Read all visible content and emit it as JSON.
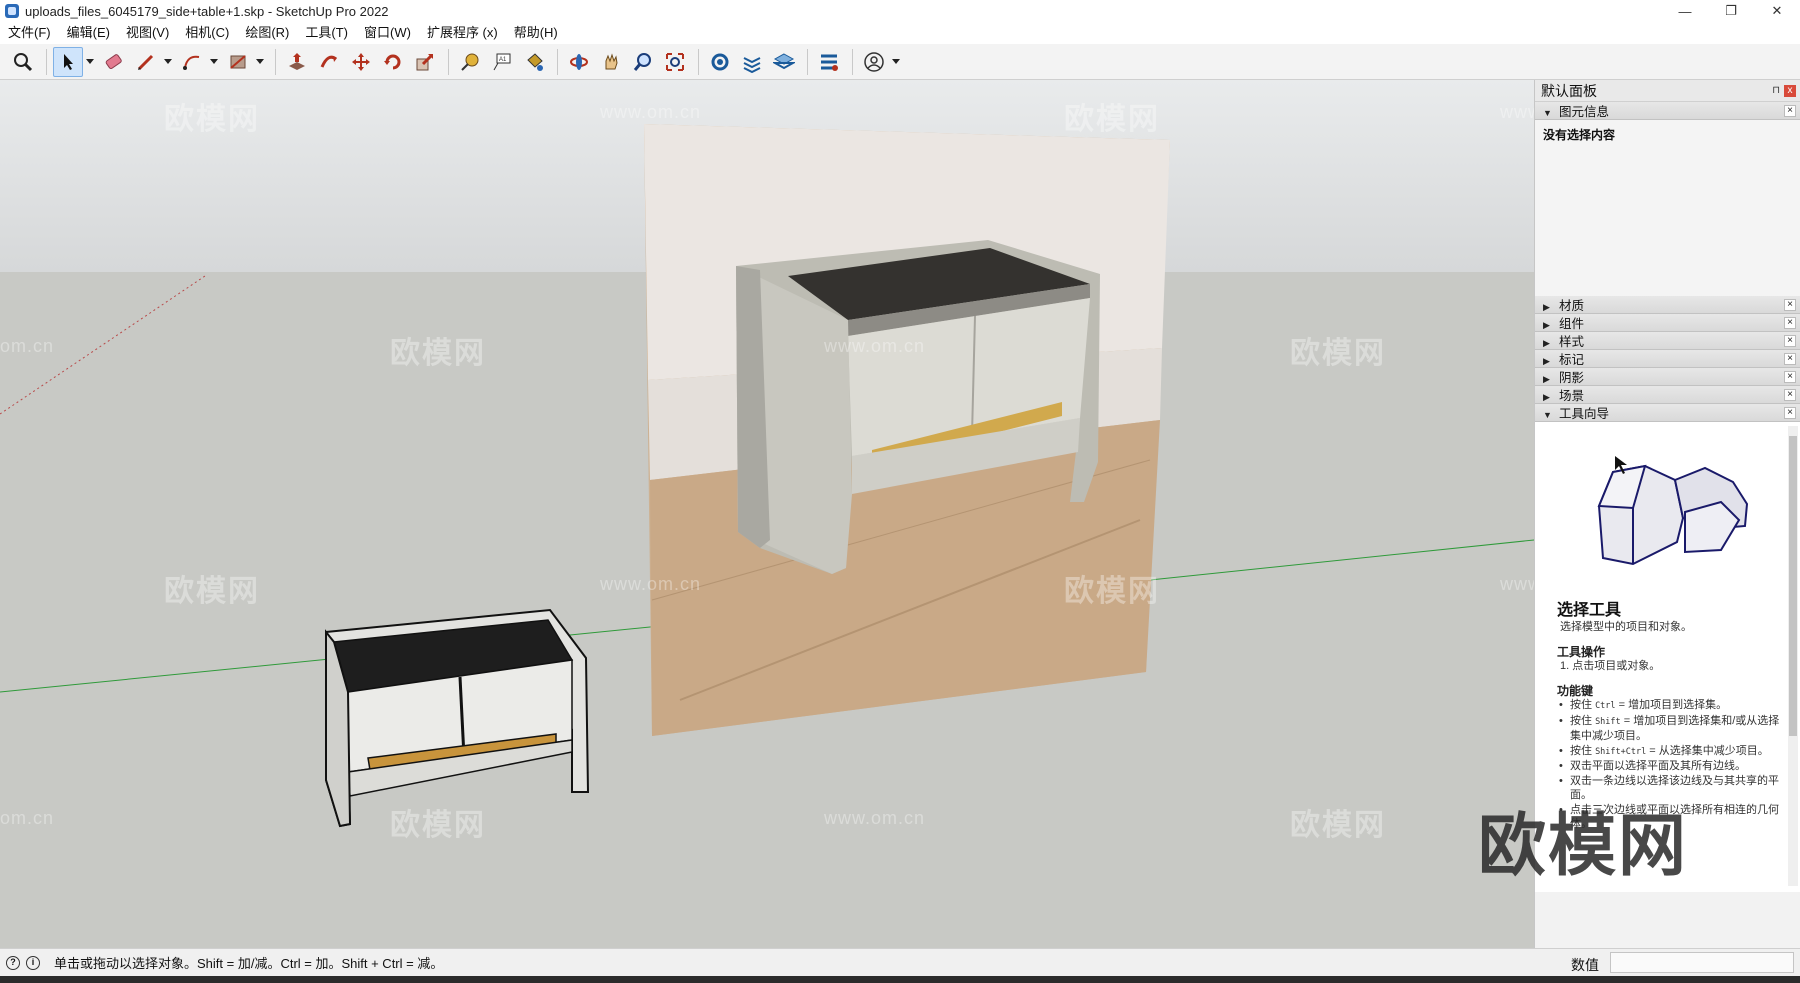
{
  "window": {
    "title": "uploads_files_6045179_side+table+1.skp - SketchUp Pro 2022",
    "minimize": "—",
    "maximize": "❐",
    "close": "✕"
  },
  "menu": [
    "文件(F)",
    "编辑(E)",
    "视图(V)",
    "相机(C)",
    "绘图(R)",
    "工具(T)",
    "窗口(W)",
    "扩展程序 (x)",
    "帮助(H)"
  ],
  "toolbar": {
    "tools": [
      "zoom-extents",
      "select",
      "eraser",
      "pencil-line",
      "arc",
      "rectangle",
      "push-pull",
      "follow-me",
      "move",
      "rotate",
      "scale",
      "tape-measure",
      "text",
      "paint-bucket",
      "orbit",
      "pan",
      "zoom",
      "zoom-window",
      "components",
      "sandbox",
      "layers",
      "extension-warehouse",
      "profile"
    ]
  },
  "viewport": {
    "watermark_text": "欧模网",
    "watermark_url": "www.om.cn",
    "watermark_url_alt": "om.cn",
    "brand_watermark": "欧模网"
  },
  "panel": {
    "title": "默认面板",
    "pin": "⊓",
    "close": "x",
    "entity_info": {
      "label": "图元信息",
      "empty_text": "没有选择内容"
    },
    "trays": [
      "材质",
      "组件",
      "样式",
      "标记",
      "阴影",
      "场景"
    ],
    "instructor": {
      "label": "工具向导",
      "title": "选择工具",
      "subtitle": "选择模型中的项目和对象。",
      "ops_title": "工具操作",
      "ops": [
        "1. 点击项目或对象。"
      ],
      "keys_title": "功能键",
      "keys": [
        {
          "pre": "按住 ",
          "key": "Ctrl",
          "post": " = 增加项目到选择集。"
        },
        {
          "pre": "按住 ",
          "key": "Shift",
          "post": " = 增加项目到选择集和/或从选择集中减少项目。"
        },
        {
          "pre": "按住 ",
          "key": "Shift+Ctrl",
          "post": " = 从选择集中减少项目。"
        },
        {
          "pre": "",
          "key": "",
          "post": "双击平面以选择平面及其所有边线。"
        },
        {
          "pre": "",
          "key": "",
          "post": "双击一条边线以选择该边线及与其共享的平面。"
        },
        {
          "pre": "",
          "key": "",
          "post": "点击三次边线或平面以选择所有相连的几何体。"
        }
      ]
    }
  },
  "status": {
    "text": "单击或拖动以选择对象。Shift = 加/减。Ctrl = 加。Shift + Ctrl = 减。",
    "measure_label": "数值",
    "measure_value": ""
  }
}
